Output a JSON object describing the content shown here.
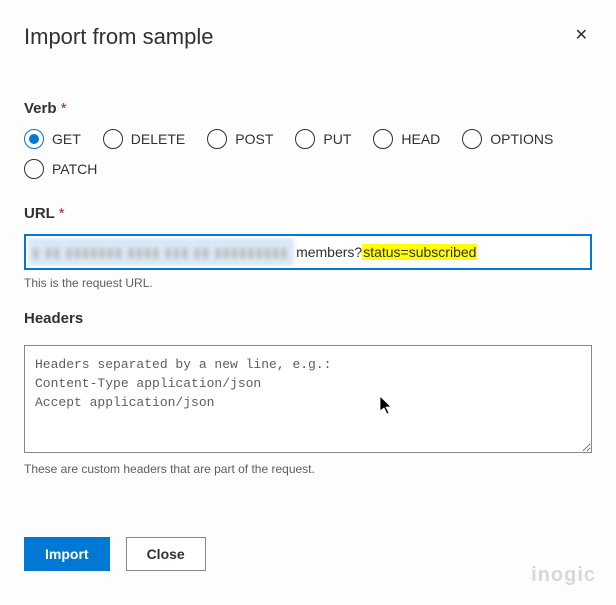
{
  "dialog": {
    "title": "Import from sample",
    "close_icon": "✕"
  },
  "verb": {
    "label": "Verb",
    "required": "*",
    "selected": "GET",
    "options": [
      "GET",
      "DELETE",
      "POST",
      "PUT",
      "HEAD",
      "OPTIONS",
      "PATCH"
    ]
  },
  "url": {
    "label": "URL",
    "required": "*",
    "blurred_prefix": "▮ ▮▮ ▮▮▮▮▮▮▮ ▮▮▮▮ ▮▮▮ ▮▮ ▮▮▮▮▮▮▮▮▮",
    "members_part": "members?",
    "highlight_part": "status=subscribed",
    "helper": "This is the request URL."
  },
  "headers": {
    "label": "Headers",
    "placeholder": "Headers separated by a new line, e.g.:\nContent-Type application/json\nAccept application/json",
    "helper": "These are custom headers that are part of the request."
  },
  "buttons": {
    "import": "Import",
    "close": "Close"
  },
  "watermark": "inogic"
}
